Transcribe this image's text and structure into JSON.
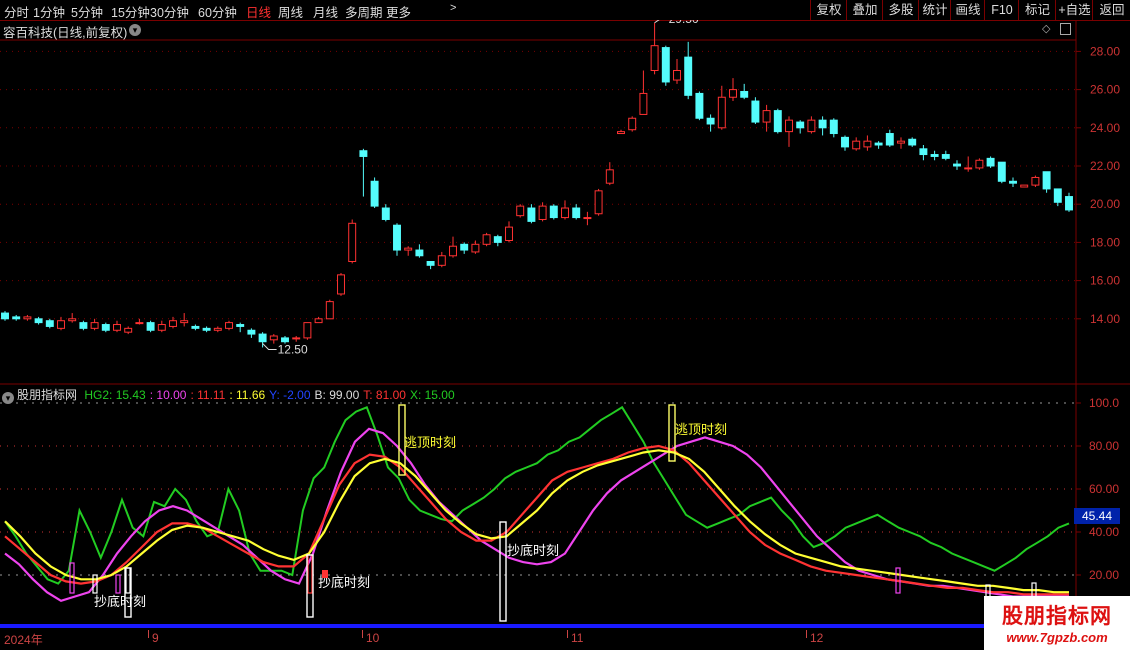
{
  "toolbar": {
    "timeframes": [
      "分时",
      "1分钟",
      "5分钟",
      "15分钟",
      "30分钟",
      "60分钟",
      "日线",
      "周线",
      "月线",
      "多周期",
      "更多"
    ],
    "active": "日线",
    "right_buttons": [
      "复权",
      "叠加",
      "多股",
      "统计",
      "画线",
      "F10",
      "标记",
      "+自选",
      "返回"
    ]
  },
  "stock_title": "容百科技(日线,前复权)",
  "price_axis": {
    "labels": [
      "28.00",
      "26.00",
      "24.00",
      "22.00",
      "20.00",
      "18.00",
      "16.00",
      "14.00"
    ],
    "values": [
      28,
      26,
      24,
      22,
      20,
      18,
      16,
      14
    ]
  },
  "max_price_label": "29.50",
  "min_price_label": "12.50",
  "candles": [
    [
      14.3,
      14.0,
      14.4,
      13.9
    ],
    [
      14.1,
      14.0,
      14.2,
      13.9
    ],
    [
      14.0,
      14.1,
      14.2,
      13.9
    ],
    [
      14.0,
      13.8,
      14.1,
      13.7
    ],
    [
      13.9,
      13.6,
      14.0,
      13.5
    ],
    [
      13.5,
      13.9,
      14.1,
      13.4
    ],
    [
      13.9,
      14.0,
      14.3,
      13.8
    ],
    [
      13.8,
      13.5,
      13.9,
      13.4
    ],
    [
      13.5,
      13.8,
      14.0,
      13.4
    ],
    [
      13.7,
      13.4,
      13.8,
      13.3
    ],
    [
      13.4,
      13.7,
      13.9,
      13.3
    ],
    [
      13.3,
      13.5,
      13.6,
      13.2
    ],
    [
      13.8,
      13.8,
      14.0,
      13.7
    ],
    [
      13.8,
      13.4,
      13.9,
      13.3
    ],
    [
      13.4,
      13.7,
      13.9,
      13.3
    ],
    [
      13.6,
      13.9,
      14.1,
      13.5
    ],
    [
      13.8,
      13.9,
      14.3,
      13.6
    ],
    [
      13.6,
      13.5,
      13.7,
      13.4
    ],
    [
      13.5,
      13.4,
      13.6,
      13.3
    ],
    [
      13.4,
      13.5,
      13.6,
      13.3
    ],
    [
      13.5,
      13.8,
      13.9,
      13.4
    ],
    [
      13.7,
      13.6,
      13.8,
      13.3
    ],
    [
      13.4,
      13.2,
      13.5,
      13.0
    ],
    [
      13.2,
      12.8,
      13.3,
      12.5
    ],
    [
      12.9,
      13.1,
      13.2,
      12.7
    ],
    [
      13.0,
      12.8,
      13.1,
      12.7
    ],
    [
      13.0,
      13.0,
      13.1,
      12.8
    ],
    [
      13.0,
      13.8,
      13.8,
      12.9
    ],
    [
      13.8,
      14.0,
      14.1,
      13.8
    ],
    [
      14.0,
      14.9,
      15.0,
      14.0
    ],
    [
      15.3,
      16.3,
      16.4,
      15.2
    ],
    [
      17.0,
      19.0,
      19.2,
      16.9
    ],
    [
      22.8,
      22.5,
      22.9,
      20.4
    ],
    [
      21.2,
      19.9,
      21.4,
      19.8
    ],
    [
      19.8,
      19.2,
      20.0,
      19.1
    ],
    [
      18.9,
      17.6,
      19.0,
      17.3
    ],
    [
      17.6,
      17.7,
      17.8,
      17.3
    ],
    [
      17.6,
      17.3,
      17.9,
      17.2
    ],
    [
      17.0,
      16.8,
      17.0,
      16.6
    ],
    [
      16.8,
      17.3,
      17.5,
      16.7
    ],
    [
      17.3,
      17.8,
      18.3,
      17.2
    ],
    [
      17.9,
      17.6,
      18.0,
      17.4
    ],
    [
      17.5,
      17.9,
      18.1,
      17.4
    ],
    [
      17.9,
      18.4,
      18.5,
      17.8
    ],
    [
      18.3,
      18.0,
      18.4,
      17.8
    ],
    [
      18.1,
      18.8,
      19.1,
      18.0
    ],
    [
      19.4,
      19.9,
      20.0,
      19.3
    ],
    [
      19.8,
      19.1,
      20.0,
      19.0
    ],
    [
      19.2,
      19.9,
      20.1,
      19.1
    ],
    [
      19.9,
      19.3,
      20.0,
      19.2
    ],
    [
      19.3,
      19.8,
      20.2,
      19.2
    ],
    [
      19.8,
      19.3,
      20.0,
      19.2
    ],
    [
      19.3,
      19.3,
      19.6,
      18.9
    ],
    [
      19.5,
      20.7,
      20.8,
      19.4
    ],
    [
      21.1,
      21.8,
      22.2,
      21.0
    ],
    [
      23.7,
      23.8,
      23.9,
      23.7
    ],
    [
      23.9,
      24.5,
      24.6,
      23.8
    ],
    [
      24.7,
      25.8,
      27.0,
      24.7
    ],
    [
      27.0,
      28.3,
      29.5,
      26.8
    ],
    [
      28.2,
      26.4,
      28.3,
      26.2
    ],
    [
      26.5,
      27.0,
      27.6,
      26.3
    ],
    [
      27.7,
      25.7,
      28.5,
      25.5
    ],
    [
      25.8,
      24.5,
      25.9,
      24.4
    ],
    [
      24.5,
      24.2,
      24.7,
      23.8
    ],
    [
      24.0,
      25.6,
      26.2,
      23.9
    ],
    [
      25.6,
      26.0,
      26.6,
      25.4
    ],
    [
      25.9,
      25.6,
      26.3,
      25.5
    ],
    [
      25.4,
      24.3,
      25.6,
      24.2
    ],
    [
      24.3,
      24.9,
      25.2,
      23.8
    ],
    [
      24.9,
      23.8,
      25.0,
      23.7
    ],
    [
      23.8,
      24.4,
      24.6,
      23.0
    ],
    [
      24.3,
      24.0,
      24.4,
      23.7
    ],
    [
      23.8,
      24.4,
      24.6,
      23.7
    ],
    [
      24.4,
      24.0,
      24.6,
      23.6
    ],
    [
      24.4,
      23.7,
      24.5,
      23.5
    ],
    [
      23.5,
      23.0,
      23.6,
      22.8
    ],
    [
      22.9,
      23.3,
      23.5,
      22.8
    ],
    [
      23.0,
      23.3,
      23.6,
      22.8
    ],
    [
      23.2,
      23.1,
      23.3,
      22.9
    ],
    [
      23.7,
      23.1,
      23.9,
      23.0
    ],
    [
      23.2,
      23.3,
      23.5,
      22.9
    ],
    [
      23.4,
      23.1,
      23.5,
      23.0
    ],
    [
      22.9,
      22.6,
      23.1,
      22.3
    ],
    [
      22.6,
      22.5,
      22.8,
      22.3
    ],
    [
      22.6,
      22.4,
      22.8,
      22.3
    ],
    [
      22.1,
      22.0,
      22.3,
      21.8
    ],
    [
      21.9,
      21.9,
      22.5,
      21.7
    ],
    [
      21.9,
      22.3,
      22.4,
      21.8
    ],
    [
      22.4,
      22.0,
      22.5,
      21.9
    ],
    [
      22.2,
      21.2,
      22.2,
      21.1
    ],
    [
      21.2,
      21.1,
      21.4,
      20.9
    ],
    [
      20.9,
      21.0,
      21.0,
      20.9
    ],
    [
      21.0,
      21.4,
      21.5,
      20.9
    ],
    [
      21.7,
      20.8,
      21.7,
      20.6
    ],
    [
      20.8,
      20.1,
      20.8,
      19.9
    ],
    [
      20.4,
      19.7,
      20.6,
      19.6
    ]
  ],
  "indicator": {
    "name": "股朋指标网",
    "legend": [
      {
        "text": "HG2: 15.43",
        "color": "#22cc22"
      },
      {
        "text": ": 10.00",
        "color": "#ee44ee"
      },
      {
        "text": ": 11.11",
        "color": "#ff3333"
      },
      {
        "text": ": 11.66",
        "color": "#ffff33"
      },
      {
        "text": "Y: -2.00",
        "color": "#2244ff"
      },
      {
        "text": "B: 99.00",
        "color": "#dddddd"
      },
      {
        "text": "T: 81.00",
        "color": "#ff3333"
      },
      {
        "text": "X: 15.00",
        "color": "#22cc22"
      }
    ],
    "axis_labels": [
      "100.0",
      "80.00",
      "60.00",
      "40.00",
      "20.00"
    ],
    "axis_values": [
      100,
      80,
      60,
      40,
      20
    ],
    "current_value": "45.44",
    "green": [
      45,
      38,
      30,
      24,
      18,
      16,
      22,
      50,
      40,
      28,
      40,
      55,
      42,
      38,
      54,
      52,
      60,
      55,
      45,
      38,
      40,
      60,
      50,
      30,
      22,
      22,
      22,
      20,
      50,
      65,
      70,
      82,
      92,
      96,
      98,
      85,
      70,
      65,
      55,
      50,
      48,
      46,
      45,
      50,
      53,
      56,
      60,
      65,
      68,
      70,
      72,
      76,
      78,
      82,
      84,
      88,
      92,
      95,
      98,
      90,
      82,
      72,
      64,
      56,
      48,
      45,
      42,
      44,
      46,
      48,
      52,
      54,
      56,
      50,
      45,
      38,
      33,
      35,
      38,
      42,
      44,
      46,
      48,
      45,
      42,
      40,
      38,
      35,
      33,
      30,
      28,
      26,
      24,
      22,
      25,
      28,
      32,
      35,
      38,
      42,
      44
    ],
    "magenta": [
      30,
      25,
      18,
      12,
      8,
      10,
      12,
      20,
      30,
      38,
      45,
      50,
      52,
      50,
      46,
      42,
      38,
      34,
      28,
      22,
      18,
      16,
      30,
      50,
      68,
      82,
      88,
      86,
      80,
      72,
      62,
      54,
      48,
      42,
      36,
      32,
      28,
      26,
      25,
      26,
      30,
      40,
      50,
      58,
      64,
      68,
      72,
      76,
      80,
      82,
      84,
      82,
      80,
      76,
      70,
      62,
      54,
      46,
      38,
      32,
      26,
      22,
      20,
      18,
      17,
      16,
      15,
      15,
      14,
      13,
      12,
      11,
      10,
      10,
      10,
      10,
      10
    ],
    "red": [
      38,
      32,
      26,
      20,
      17,
      16,
      17,
      20,
      26,
      33,
      40,
      44,
      44,
      42,
      38,
      34,
      30,
      26,
      24,
      24,
      30,
      46,
      62,
      72,
      76,
      75,
      70,
      62,
      54,
      46,
      40,
      36,
      36,
      40,
      48,
      56,
      64,
      68,
      70,
      72,
      74,
      77,
      79,
      80,
      78,
      72,
      64,
      56,
      48,
      40,
      34,
      30,
      27,
      24,
      22,
      21,
      20,
      19,
      18,
      17,
      16,
      15,
      14,
      14,
      13,
      12,
      12,
      11,
      11,
      11,
      11
    ],
    "yellow": [
      45,
      38,
      30,
      24,
      20,
      18,
      18,
      20,
      24,
      30,
      36,
      41,
      43,
      42,
      40,
      38,
      36,
      32,
      29,
      27,
      30,
      40,
      54,
      66,
      72,
      74,
      72,
      66,
      58,
      50,
      44,
      39,
      37,
      38,
      44,
      50,
      58,
      64,
      68,
      71,
      73,
      75,
      77,
      78,
      77,
      74,
      68,
      60,
      52,
      45,
      39,
      34,
      30,
      28,
      26,
      24,
      23,
      22,
      21,
      20,
      19,
      18,
      17,
      16,
      15,
      15,
      14,
      13,
      13,
      12,
      12
    ],
    "signals": [
      {
        "label": "抄底时刻",
        "x": 0
      },
      {
        "label": "抄底时刻",
        "x": 1
      },
      {
        "label": "逃顶时刻",
        "x": 2
      },
      {
        "label": "抄底时刻",
        "x": 3
      },
      {
        "label": "逃顶时刻",
        "x": 4
      }
    ]
  },
  "dates": [
    {
      "label": "2024年"
    },
    {
      "label": "9"
    },
    {
      "label": "10"
    },
    {
      "label": "11"
    },
    {
      "label": "12"
    }
  ],
  "watermark": {
    "title": "股朋指标网",
    "url": "www.7gpzb.com"
  },
  "colors": {
    "up": "#ff3232",
    "down": "#54fcfc",
    "grid": "#7a0000",
    "dotgrid": "#cc3333"
  }
}
